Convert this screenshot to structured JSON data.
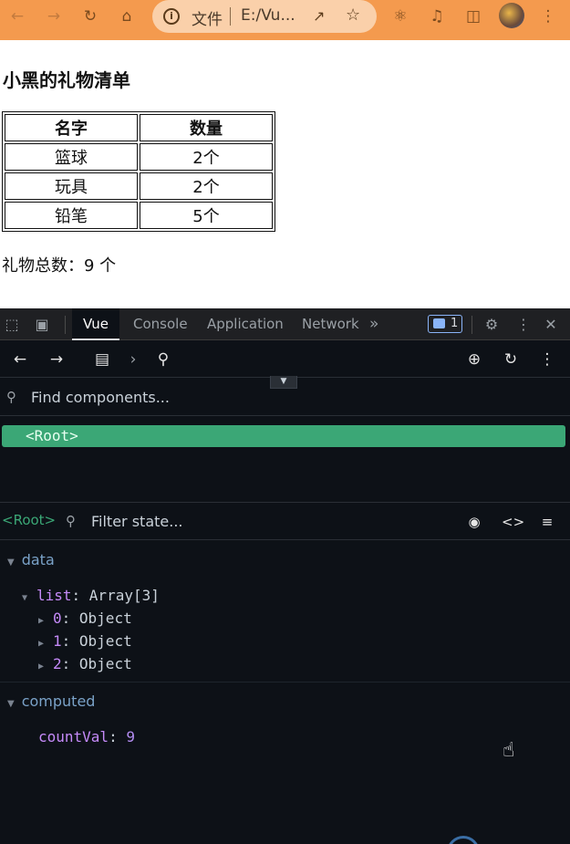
{
  "browser": {
    "scheme_label": "文件",
    "url": "E:/Vu...",
    "nav_icons": [
      "back-icon",
      "forward-icon",
      "reload-icon",
      "home-icon"
    ],
    "action_icons": [
      "extensions-icon",
      "media-icon",
      "sidepanel-icon",
      "avatar",
      "menu-icon"
    ]
  },
  "page": {
    "title": "小黑的礼物清单",
    "table": {
      "headers": [
        "名字",
        "数量"
      ],
      "rows": [
        [
          "篮球",
          "2个"
        ],
        [
          "玩具",
          "2个"
        ],
        [
          "铅笔",
          "5个"
        ]
      ]
    },
    "total_text": "礼物总数：9 个"
  },
  "devtools": {
    "tabs": [
      "Vue",
      "Console",
      "Application",
      "Network"
    ],
    "active_tab": "Vue",
    "more_tabs": "»",
    "issues_count": "1",
    "find_placeholder": "Find components...",
    "root_component": "<Root>",
    "selected_tag": "<Root>",
    "filter_placeholder": "Filter state...",
    "sections": {
      "data_label": "data",
      "list_key": "list",
      "list_value": "Array[3]",
      "items": [
        {
          "key": "0",
          "value": "Object"
        },
        {
          "key": "1",
          "value": "Object"
        },
        {
          "key": "2",
          "value": "Object"
        }
      ],
      "computed_label": "computed",
      "computed_key": "countVal",
      "computed_value": "9"
    }
  },
  "colors": {
    "browser_bar": "#f49a4e",
    "vue_green": "#3ba776",
    "devtools_bg": "#0d1117"
  }
}
